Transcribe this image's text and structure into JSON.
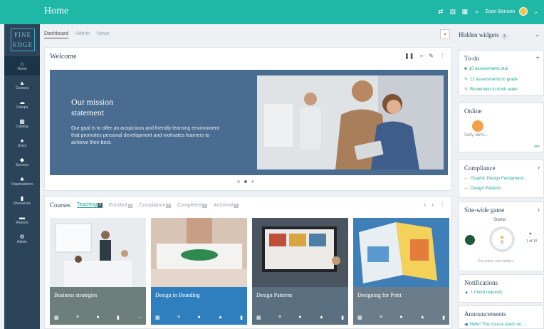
{
  "topbar": {
    "title": "Home",
    "user_name": "Zoon Benson",
    "colors": {
      "bar": "#1fb8a6"
    }
  },
  "sidebar": {
    "logo_line1": "FINE",
    "logo_line2": "EDGE",
    "items": [
      {
        "label": "Home",
        "icon": "home-icon"
      },
      {
        "label": "Courses",
        "icon": "courses-icon"
      },
      {
        "label": "Groups",
        "icon": "groups-icon"
      },
      {
        "label": "Catalog",
        "icon": "catalog-icon"
      },
      {
        "label": "Users",
        "icon": "users-icon"
      },
      {
        "label": "Surveys",
        "icon": "surveys-icon"
      },
      {
        "label": "Organizations",
        "icon": "organizations-icon"
      },
      {
        "label": "Resources",
        "icon": "resources-icon"
      },
      {
        "label": "Reports",
        "icon": "reports-icon"
      },
      {
        "label": "Admin",
        "icon": "admin-icon"
      }
    ]
  },
  "subtabs": [
    "Dashboard",
    "Admin",
    "News"
  ],
  "welcome": {
    "title": "Welcome",
    "heading_line1": "Our mission",
    "heading_line2": "statement",
    "body": "Our goal is to offer an auspicious and friendly learning environment that promotes personal development and motivates learners to achieve their best."
  },
  "courses": {
    "title": "Courses",
    "tabs": [
      {
        "label": "Teaching",
        "count": "4"
      },
      {
        "label": "Enrolled",
        "count": "1"
      },
      {
        "label": "Compliance",
        "count": "1"
      },
      {
        "label": "Completed",
        "count": "1"
      },
      {
        "label": "Archived",
        "count": "1"
      }
    ],
    "cards": [
      {
        "title": "Business strategies",
        "color": "#6d7f7b"
      },
      {
        "title": "Design in Branding",
        "color": "#2f7fbf"
      },
      {
        "title": "Design Patterns",
        "color": "#5a6f7f"
      },
      {
        "title": "Designing for Print",
        "color": "#6b7d8b"
      }
    ]
  },
  "right": {
    "hidden_widgets": "Hidden widgets",
    "hidden_count": "1",
    "todo": {
      "title": "To-do",
      "items": [
        "10 assessments due",
        "12 assessments to grade",
        "Remember to drink water"
      ]
    },
    "online": {
      "title": "Online",
      "user": "Sally Jenn...",
      "more": "see"
    },
    "compliance": {
      "title": "Compliance",
      "items": [
        "Graphic Design Fundament...",
        "Design Patterns"
      ]
    },
    "game": {
      "title": "Site-wide game",
      "level": "Starter",
      "score": "0",
      "next": "1 of 10",
      "caption": "Get points and badges"
    },
    "notifications": {
      "title": "Notifications",
      "item": "1 friend requests"
    },
    "announcements": {
      "title": "Announcements",
      "item": "Hello! This course starts on..."
    }
  }
}
